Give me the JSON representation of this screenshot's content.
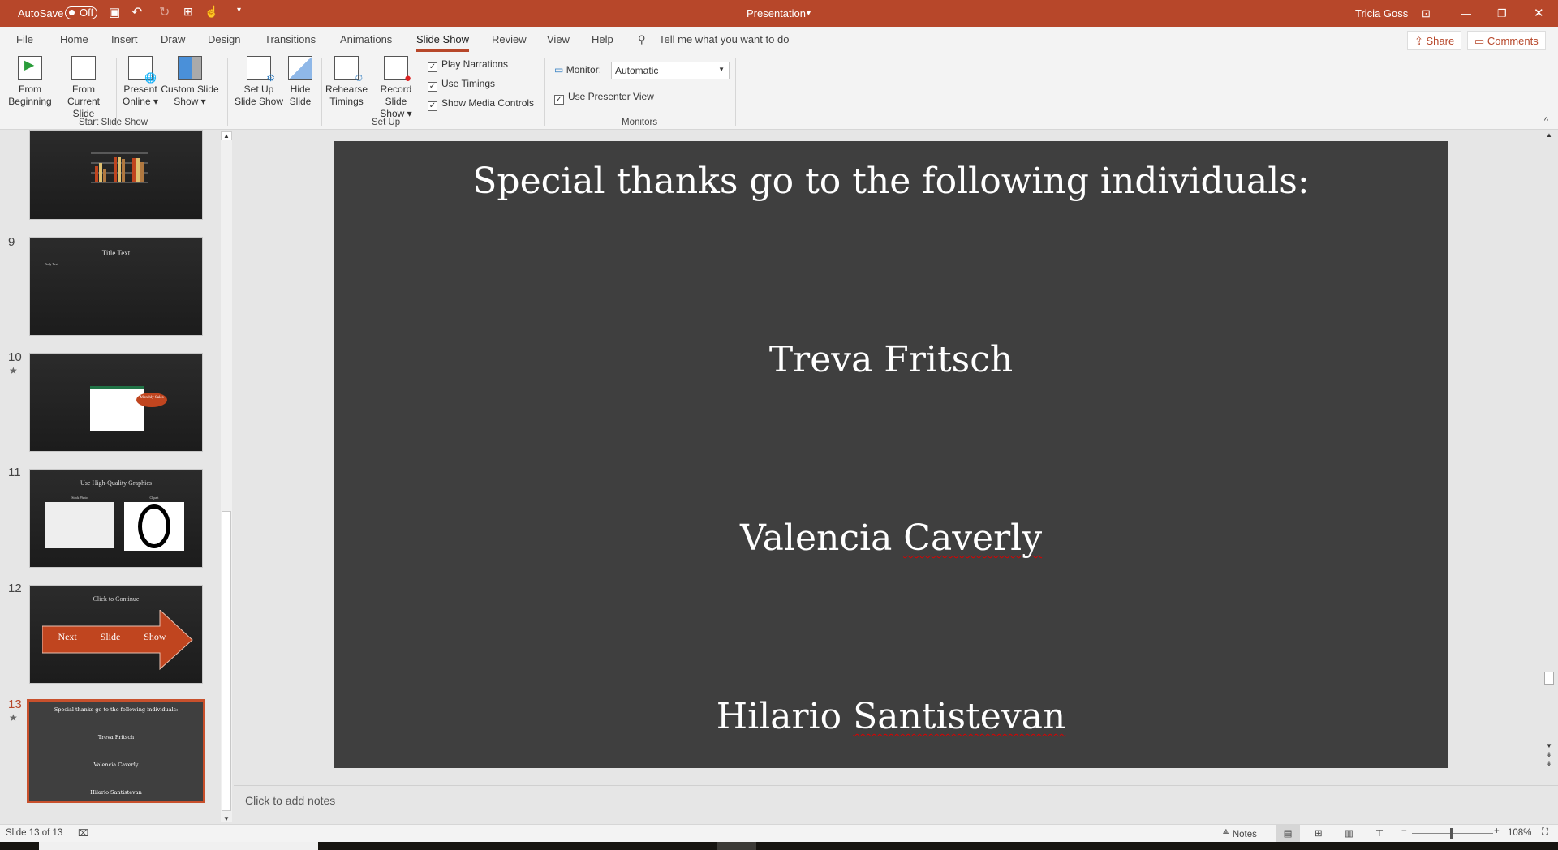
{
  "titlebar": {
    "autosave_label": "AutoSave",
    "autosave_state": "Off",
    "doc_title": "Presentation",
    "user": "Tricia Goss",
    "accent": "#b7472a"
  },
  "tabs": [
    {
      "label": "File"
    },
    {
      "label": "Home"
    },
    {
      "label": "Insert"
    },
    {
      "label": "Draw"
    },
    {
      "label": "Design"
    },
    {
      "label": "Transitions"
    },
    {
      "label": "Animations"
    },
    {
      "label": "Slide Show",
      "active": true
    },
    {
      "label": "Review"
    },
    {
      "label": "View"
    },
    {
      "label": "Help"
    }
  ],
  "search": {
    "placeholder": "Tell me what you want to do"
  },
  "share_label": "Share",
  "comments_label": "Comments",
  "ribbon": {
    "start": {
      "from_beginning": [
        "From",
        "Beginning"
      ],
      "from_current": [
        "From",
        "Current Slide"
      ],
      "present_online": [
        "Present",
        "Online"
      ],
      "custom_show": [
        "Custom Slide",
        "Show"
      ],
      "group": "Start Slide Show"
    },
    "setup": {
      "setup_show": [
        "Set Up",
        "Slide Show"
      ],
      "hide_slide": [
        "Hide",
        "Slide"
      ],
      "rehearse": [
        "Rehearse",
        "Timings"
      ],
      "record": [
        "Record Slide",
        "Show"
      ],
      "play_narrations": "Play Narrations",
      "use_timings": "Use Timings",
      "show_media": "Show Media Controls",
      "group": "Set Up"
    },
    "monitors": {
      "monitor_label": "Monitor:",
      "monitor_value": "Automatic",
      "presenter_view": "Use Presenter View",
      "group": "Monitors"
    }
  },
  "thumbnails": [
    {
      "number": "8",
      "title": ""
    },
    {
      "number": "9",
      "title": "Title Text",
      "body": "Body Text"
    },
    {
      "number": "10",
      "callout": "Monthly Sales",
      "animated": true
    },
    {
      "number": "11",
      "title": "Use High-Quality Graphics",
      "left_caption": "Stock Photo",
      "right_caption": "Clipart"
    },
    {
      "number": "12",
      "title": "Click to Continue",
      "arrow": [
        "Next",
        "Slide",
        "Show"
      ]
    },
    {
      "number": "13",
      "title": "Special thanks go to the following individuals:",
      "names": [
        "Treva Fritsch",
        "Valencia Caverly",
        "Hilario Santistevan"
      ],
      "animated": true,
      "selected": true
    }
  ],
  "slide": {
    "title": "Special thanks go to the following individuals:",
    "names": [
      "Treva Fritsch",
      "Valencia Caverly",
      "Hilario Santistevan"
    ]
  },
  "notes_placeholder": "Click to add notes",
  "status": {
    "slide_info": "Slide 13 of 13",
    "notes_label": "Notes",
    "zoom": "108%"
  }
}
